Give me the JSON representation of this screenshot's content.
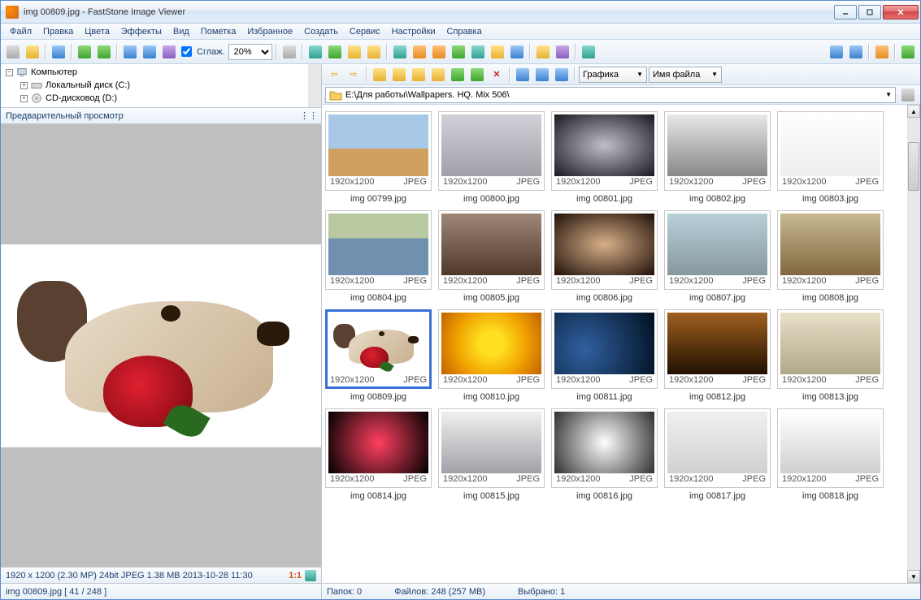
{
  "window": {
    "title": "img 00809.jpg  -  FastStone Image Viewer"
  },
  "menu": [
    "Файл",
    "Правка",
    "Цвета",
    "Эффекты",
    "Вид",
    "Пометка",
    "Избранное",
    "Создать",
    "Сервис",
    "Настройки",
    "Справка"
  ],
  "toolbar": {
    "smooth_label": "Сглаж.",
    "zoom_value": "20%"
  },
  "tree": {
    "root": "Компьютер",
    "drive_c": "Локальный диск (C:)",
    "drive_d": "CD-дисковод (D:)"
  },
  "preview": {
    "header": "Предварительный просмотр",
    "info": "1920 x 1200 (2.30 MP)  24bit  JPEG  1.38 MB  2013-10-28 11:30",
    "ratio": "1:1",
    "file_pos": "img 00809.jpg  [ 41 / 248 ]"
  },
  "nav": {
    "view_mode": "Графика",
    "sort_mode": "Имя файла"
  },
  "address": {
    "path": "E:\\Для работы\\Wallpapers. HQ. Mix 506\\"
  },
  "thumb_meta": {
    "res": "1920x1200",
    "fmt": "JPEG"
  },
  "thumbs": [
    {
      "name": "img 00799.jpg",
      "sc": "sc-city"
    },
    {
      "name": "img 00800.jpg",
      "sc": "sc-bench"
    },
    {
      "name": "img 00801.jpg",
      "sc": "sc-smoke"
    },
    {
      "name": "img 00802.jpg",
      "sc": "sc-police"
    },
    {
      "name": "img 00803.jpg",
      "sc": "sc-cat"
    },
    {
      "name": "img 00804.jpg",
      "sc": "sc-river"
    },
    {
      "name": "img 00805.jpg",
      "sc": "sc-girl1"
    },
    {
      "name": "img 00806.jpg",
      "sc": "sc-girl2"
    },
    {
      "name": "img 00807.jpg",
      "sc": "sc-stone"
    },
    {
      "name": "img 00808.jpg",
      "sc": "sc-room"
    },
    {
      "name": "img 00809.jpg",
      "sc": "sc-dog",
      "sel": true
    },
    {
      "name": "img 00810.jpg",
      "sc": "sc-flower"
    },
    {
      "name": "img 00811.jpg",
      "sc": "sc-space"
    },
    {
      "name": "img 00812.jpg",
      "sc": "sc-tiger"
    },
    {
      "name": "img 00813.jpg",
      "sc": "sc-ad"
    },
    {
      "name": "img 00814.jpg",
      "sc": "sc-heart"
    },
    {
      "name": "img 00815.jpg",
      "sc": "sc-anime"
    },
    {
      "name": "img 00816.jpg",
      "sc": "sc-dand"
    },
    {
      "name": "img 00817.jpg",
      "sc": "sc-vehicle"
    },
    {
      "name": "img 00818.jpg",
      "sc": "sc-moto"
    }
  ],
  "status_right": {
    "folders": "Папок: 0",
    "files": "Файлов: 248 (257 MB)",
    "selected": "Выбрано: 1"
  }
}
